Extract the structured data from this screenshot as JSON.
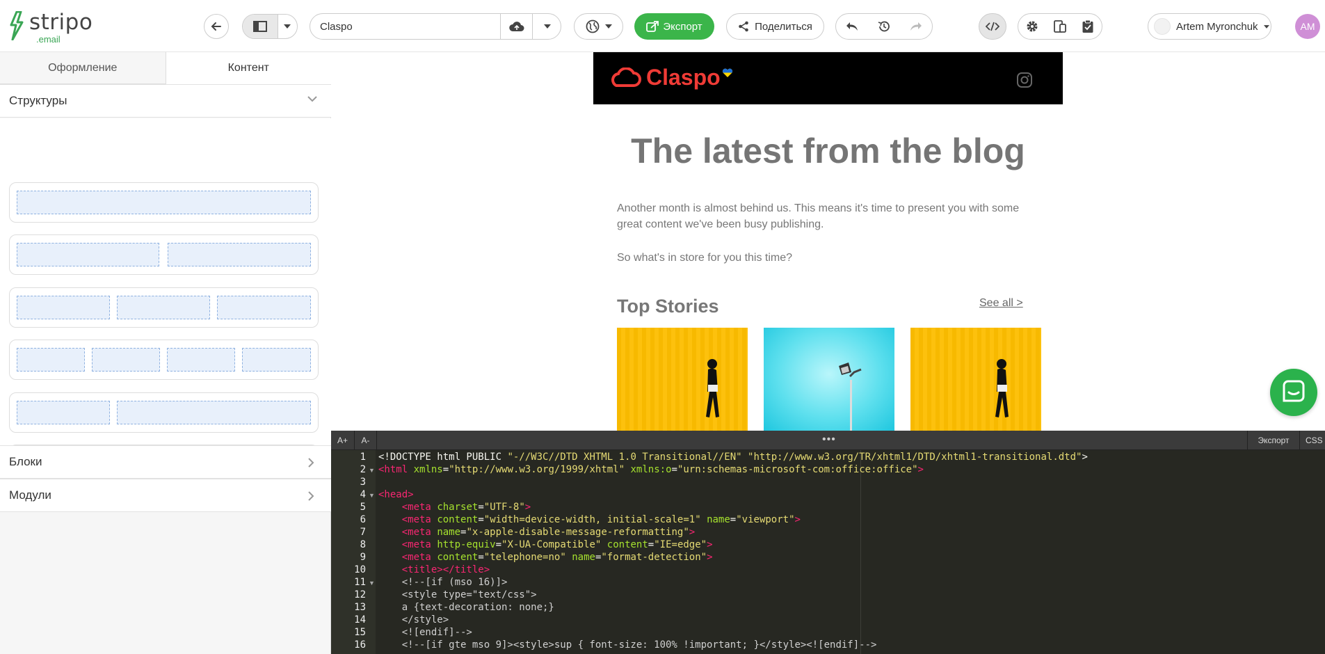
{
  "app": {
    "logo": {
      "name": "stripo",
      "sub": ".email"
    }
  },
  "toolbar": {
    "template_name": "Claspo",
    "export_label": "Экспорт",
    "share_label": "Поделиться",
    "user_name": "Artem Myronchuk",
    "user_initials": "AM"
  },
  "sidebar": {
    "tabs": [
      {
        "label": "Оформление",
        "active": false
      },
      {
        "label": "Контент",
        "active": true
      }
    ],
    "sections": {
      "structures": "Структуры",
      "blocks": "Блоки",
      "modules": "Модули"
    },
    "structure_rows": [
      {
        "columns": [
          1
        ]
      },
      {
        "columns": [
          1,
          1
        ]
      },
      {
        "columns": [
          1,
          1,
          1
        ]
      },
      {
        "columns": [
          1,
          1,
          1,
          1
        ]
      },
      {
        "columns": [
          1,
          2
        ]
      },
      {
        "columns": [
          2,
          1
        ]
      }
    ]
  },
  "email": {
    "brand": "Claspo",
    "title": "The latest from the blog",
    "intro_1": "Another month is almost behind us. This means it's time to present you with some great content we've been busy publishing.",
    "intro_2": "So what's in store for you this time?",
    "section_title": "Top Stories",
    "see_all": "See all >"
  },
  "editor": {
    "font_increase": "A+",
    "font_decrease": "A-",
    "export_label": "Экспорт",
    "css_label": "CSS",
    "lines": [
      "1",
      "2",
      "3",
      "4",
      "5",
      "6",
      "7",
      "8",
      "9",
      "10",
      "11",
      "12",
      "13",
      "14",
      "15",
      "16"
    ]
  },
  "colors": {
    "accent_green": "#3bb54a",
    "chat_green": "#2bb24c",
    "claspo_red": "#ef3b36",
    "avatar_purple": "#cf8fd6",
    "editor_bg": "#272822"
  }
}
